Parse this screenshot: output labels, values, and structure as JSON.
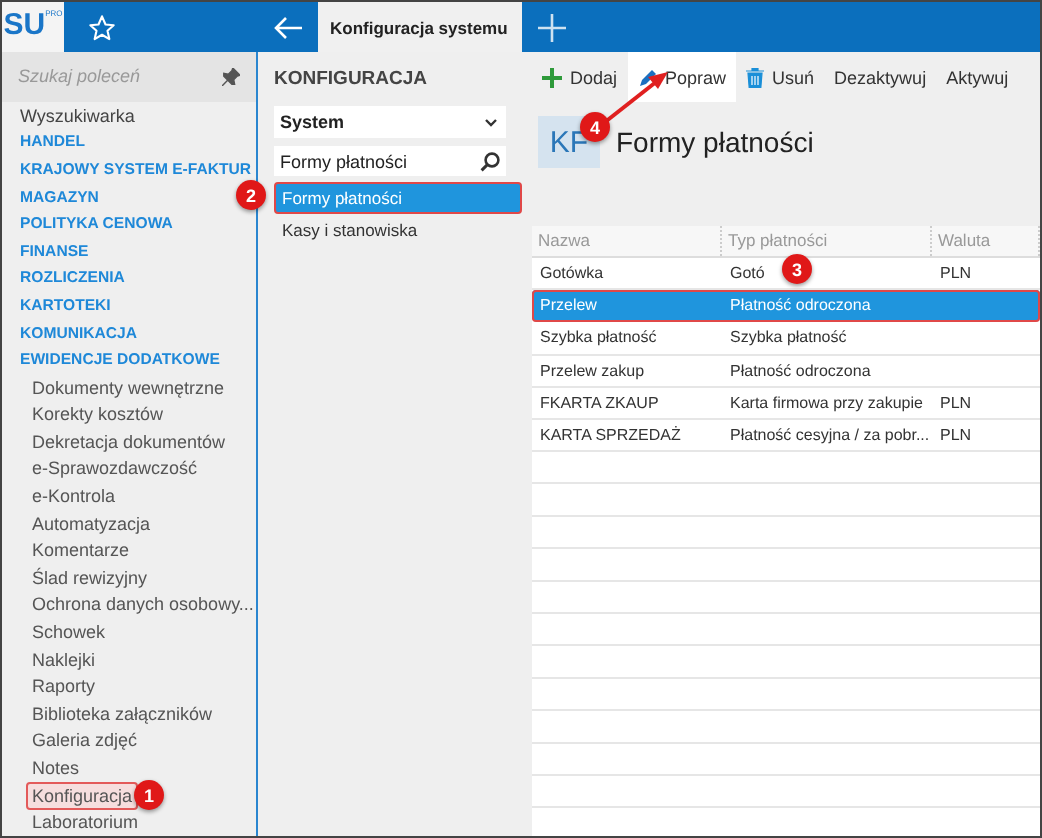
{
  "logo": {
    "text": "SU",
    "superscript": "PRO"
  },
  "top_tabs": [
    {
      "label": "Konfiguracja systemu",
      "selected": true
    }
  ],
  "sidebar": {
    "search": {
      "placeholder": "Szukaj poleceń"
    },
    "items": [
      {
        "label": "Wyszukiwarka",
        "kind": "plain",
        "highlighted": false
      },
      {
        "label": "HANDEL",
        "kind": "section",
        "highlighted": false
      },
      {
        "label": "KRAJOWY SYSTEM E-FAKTUR",
        "kind": "section",
        "highlighted": false
      },
      {
        "label": "MAGAZYN",
        "kind": "section",
        "highlighted": false
      },
      {
        "label": "POLITYKA CENOWA",
        "kind": "section",
        "highlighted": false
      },
      {
        "label": "FINANSE",
        "kind": "section",
        "highlighted": false
      },
      {
        "label": "ROZLICZENIA",
        "kind": "section",
        "highlighted": false
      },
      {
        "label": "KARTOTEKI",
        "kind": "section",
        "highlighted": false
      },
      {
        "label": "KOMUNIKACJA",
        "kind": "section",
        "highlighted": false
      },
      {
        "label": "EWIDENCJE DODATKOWE",
        "kind": "section",
        "highlighted": false
      },
      {
        "label": "Dokumenty wewnętrzne",
        "kind": "sub",
        "highlighted": false
      },
      {
        "label": "Korekty kosztów",
        "kind": "sub",
        "highlighted": false
      },
      {
        "label": "Dekretacja dokumentów",
        "kind": "sub",
        "highlighted": false
      },
      {
        "label": "e-Sprawozdawczość",
        "kind": "sub",
        "highlighted": false
      },
      {
        "label": "e-Kontrola",
        "kind": "sub",
        "highlighted": false
      },
      {
        "label": "Automatyzacja",
        "kind": "sub",
        "highlighted": false
      },
      {
        "label": "Komentarze",
        "kind": "sub",
        "highlighted": false
      },
      {
        "label": "Ślad rewizyjny",
        "kind": "sub",
        "highlighted": false
      },
      {
        "label": "Ochrona danych osobowy...",
        "kind": "sub",
        "highlighted": false
      },
      {
        "label": "Schowek",
        "kind": "sub",
        "highlighted": false
      },
      {
        "label": "Naklejki",
        "kind": "sub",
        "highlighted": false
      },
      {
        "label": "Raporty",
        "kind": "sub",
        "highlighted": false
      },
      {
        "label": "Biblioteka załączników",
        "kind": "sub",
        "highlighted": false
      },
      {
        "label": "Galeria zdjęć",
        "kind": "sub",
        "highlighted": false
      },
      {
        "label": "Notes",
        "kind": "sub",
        "highlighted": false
      },
      {
        "label": "Konfiguracja",
        "kind": "sub",
        "highlighted": true
      },
      {
        "label": "Laboratorium",
        "kind": "sub",
        "highlighted": false
      }
    ]
  },
  "config_panel": {
    "title": "KONFIGURACJA",
    "dropdown": "System",
    "search": {
      "value": "Formy płatności"
    },
    "items": [
      {
        "label": "Formy płatności",
        "selected": true
      },
      {
        "label": "Kasy i stanowiska",
        "selected": false
      }
    ]
  },
  "toolbar": [
    {
      "label": "Dodaj",
      "kind": "add",
      "selected": false
    },
    {
      "label": "Popraw",
      "kind": "edit",
      "selected": true
    },
    {
      "label": "Usuń",
      "kind": "delete",
      "selected": false
    },
    {
      "label": "Dezaktywuj",
      "kind": "text",
      "selected": false
    },
    {
      "label": "Aktywuj",
      "kind": "text",
      "selected": false
    }
  ],
  "header": {
    "badge": "KF",
    "title": "Formy płatności"
  },
  "table": {
    "columns": [
      "Nazwa",
      "Typ płatności",
      "Waluta"
    ],
    "rows": [
      {
        "cells": [
          "Gotówka",
          "Gotó",
          "PLN"
        ],
        "selected": false
      },
      {
        "cells": [
          "Przelew",
          "Płatność odroczona",
          ""
        ],
        "selected": true
      },
      {
        "cells": [
          "Szybka płatność",
          "Szybka płatność",
          ""
        ],
        "selected": false
      },
      {
        "cells": [
          "Przelew zakup",
          "Płatność odroczona",
          ""
        ],
        "selected": false
      },
      {
        "cells": [
          "FKARTA ZKAUP",
          "Karta firmowa przy zakupie",
          "PLN"
        ],
        "selected": false
      },
      {
        "cells": [
          "KARTA SPRZEDAŻ",
          "Płatność cesyjna / za pobr...",
          "PLN"
        ],
        "selected": false
      }
    ]
  },
  "annotations": [
    "1",
    "2",
    "3",
    "4"
  ]
}
